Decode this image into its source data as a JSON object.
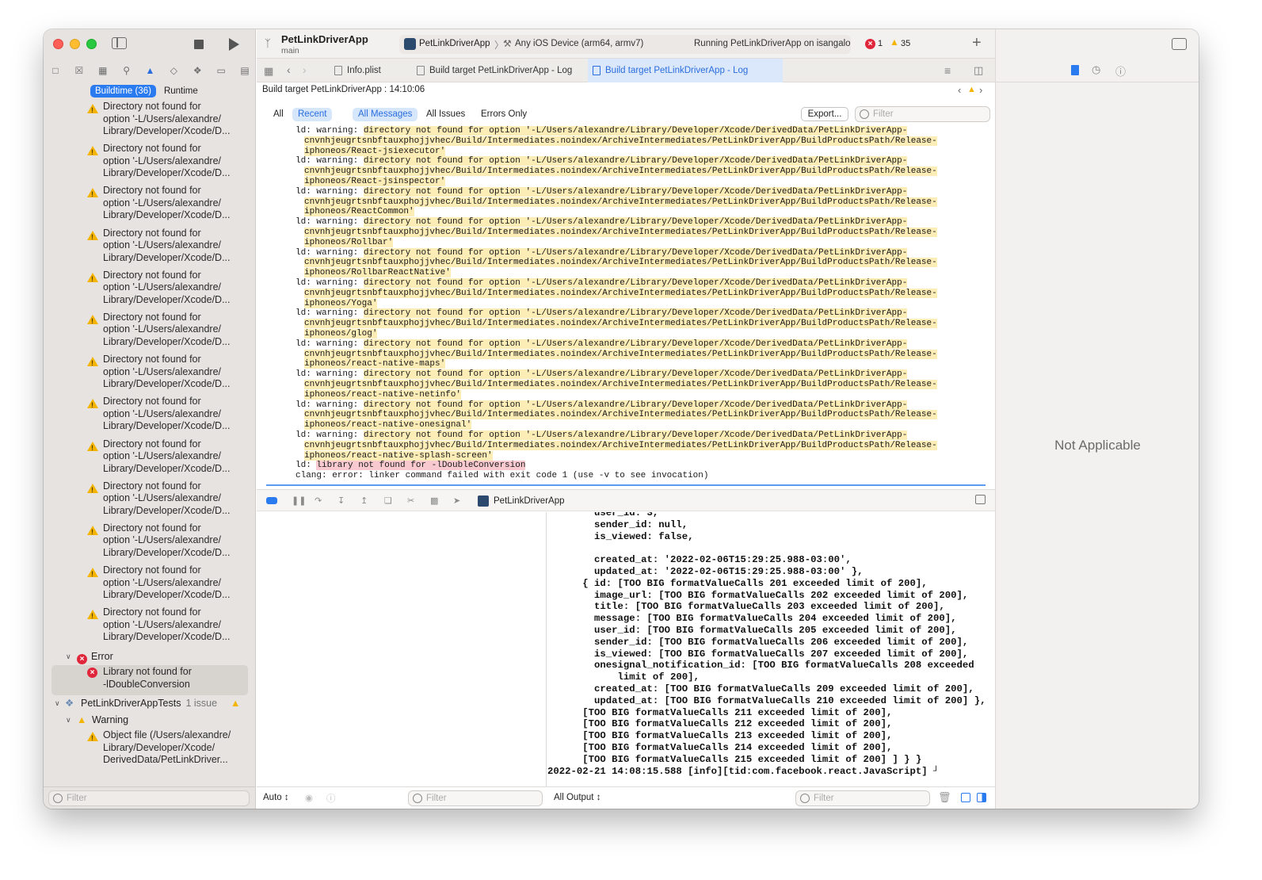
{
  "window": {
    "project_name": "PetLinkDriverApp",
    "branch": "main",
    "scheme": "PetLinkDriverApp",
    "destination": "Any iOS Device (arm64, armv7)",
    "status": "Running PetLinkDriverApp on isangalo",
    "error_count": "1",
    "warning_count": "35"
  },
  "navigator": {
    "segments": [
      "Buildtime (36)",
      "Runtime"
    ],
    "warning_issue_lines": [
      "Directory not found for",
      "option '-L/Users/alexandre/",
      "Library/Developer/Xcode/D..."
    ],
    "warning_issue_count": 13,
    "error_group_label": "Error",
    "error_issue_lines": [
      "Library not found for",
      "-lDoubleConversion"
    ],
    "tests_target_label": "PetLinkDriverAppTests",
    "tests_issue_count": "1 issue",
    "warning_group_label": "Warning",
    "object_issue_lines": [
      "Object file (/Users/alexandre/",
      "Library/Developer/Xcode/",
      "DerivedData/PetLinkDriver..."
    ],
    "filter_placeholder": "Filter"
  },
  "tabs": [
    {
      "label": "Info.plist"
    },
    {
      "label": "Build target PetLinkDriverApp - Log"
    },
    {
      "label": "Build target PetLinkDriverApp - Log"
    }
  ],
  "log": {
    "title": "Build target PetLinkDriverApp : 14:10:06",
    "filters": [
      "All",
      "Recent",
      "All Messages",
      "All Issues",
      "Errors Only"
    ],
    "export_label": "Export...",
    "filter_placeholder": "Filter",
    "warning_prefix": "ld: warning: ",
    "warning_text_1": "directory not found for option '-L/Users/alexandre/Library/Developer/Xcode/DerivedData/PetLinkDriverApp-",
    "warning_text_2": "cnvnhjeugrtsnbftauxphojjvhec/Build/Intermediates.noindex/ArchiveIntermediates/PetLinkDriverApp/BuildProductsPath/Release-",
    "warning_targets": [
      "iphoneos/React-jsiexecutor'",
      "iphoneos/React-jsinspector'",
      "iphoneos/ReactCommon'",
      "iphoneos/Rollbar'",
      "iphoneos/RollbarReactNative'",
      "iphoneos/Yoga'",
      "iphoneos/glog'",
      "iphoneos/react-native-maps'",
      "iphoneos/react-native-netinfo'",
      "iphoneos/react-native-onesignal'",
      "iphoneos/react-native-splash-screen'"
    ],
    "error_prefix": "ld: ",
    "error_text": "library not found for -lDoubleConversion",
    "clang_line": "clang: error: linker command failed with exit code 1 (use -v to see invocation)"
  },
  "debug": {
    "process_label": "PetLinkDriverApp"
  },
  "console": {
    "lines": [
      "        user_id: 3,",
      "        sender_id: null,",
      "        is_viewed: false,",
      "",
      "        created_at: '2022-02-06T15:29:25.988-03:00',",
      "        updated_at: '2022-02-06T15:29:25.988-03:00' },",
      "      { id: [TOO BIG formatValueCalls 201 exceeded limit of 200],",
      "        image_url: [TOO BIG formatValueCalls 202 exceeded limit of 200],",
      "        title: [TOO BIG formatValueCalls 203 exceeded limit of 200],",
      "        message: [TOO BIG formatValueCalls 204 exceeded limit of 200],",
      "        user_id: [TOO BIG formatValueCalls 205 exceeded limit of 200],",
      "        sender_id: [TOO BIG formatValueCalls 206 exceeded limit of 200],",
      "        is_viewed: [TOO BIG formatValueCalls 207 exceeded limit of 200],",
      "        onesignal_notification_id: [TOO BIG formatValueCalls 208 exceeded",
      "            limit of 200],",
      "        created_at: [TOO BIG formatValueCalls 209 exceeded limit of 200],",
      "        updated_at: [TOO BIG formatValueCalls 210 exceeded limit of 200] },",
      "      [TOO BIG formatValueCalls 211 exceeded limit of 200],",
      "      [TOO BIG formatValueCalls 212 exceeded limit of 200],",
      "      [TOO BIG formatValueCalls 213 exceeded limit of 200],",
      "      [TOO BIG formatValueCalls 214 exceeded limit of 200],",
      "      [TOO BIG formatValueCalls 215 exceeded limit of 200] ] } }",
      "2022-02-21 14:08:15.588 [info][tid:com.facebook.react.JavaScript] ┘"
    ],
    "auto_label": "Auto ↕",
    "output_label": "All Output ↕",
    "filter_placeholder": "Filter"
  },
  "inspector": {
    "not_applicable": "Not Applicable"
  }
}
